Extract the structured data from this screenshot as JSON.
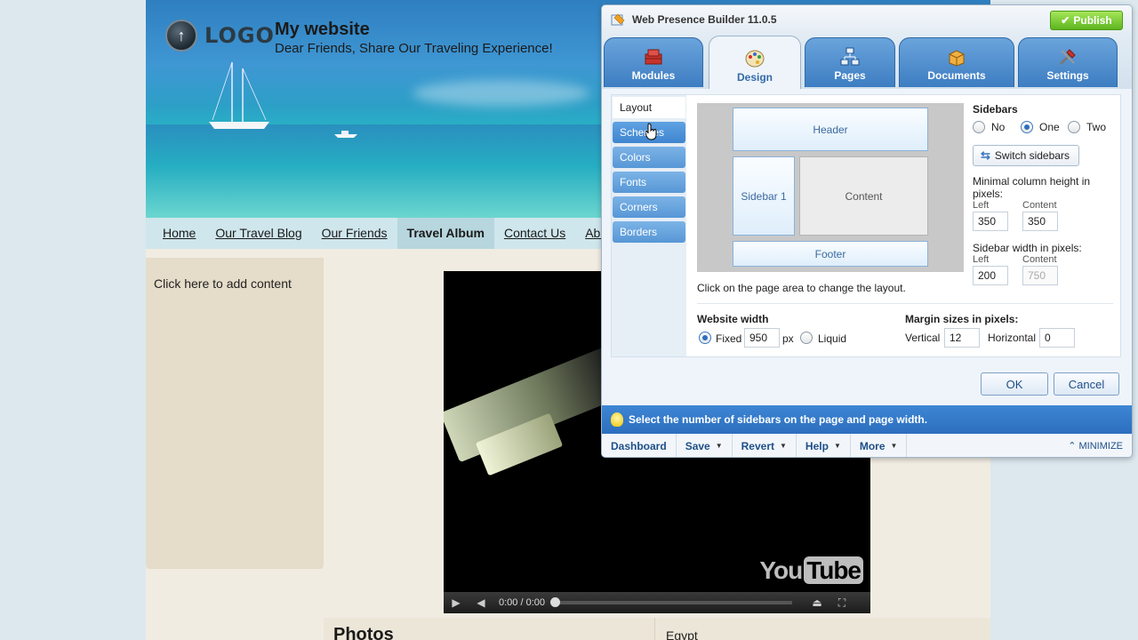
{
  "site": {
    "logo_text": "LOGO",
    "title": "My website",
    "slogan": "Dear Friends, Share Our Traveling Experience!",
    "nav": [
      {
        "label": "Home"
      },
      {
        "label": "Our Travel Blog"
      },
      {
        "label": "Our Friends"
      },
      {
        "label": "Travel Album",
        "active": true
      },
      {
        "label": "Contact Us"
      },
      {
        "label": "About"
      }
    ],
    "add_content": "Click here to add content",
    "video": {
      "time": "0:00 / 0:00",
      "brand_you": "You",
      "brand_tube": "Tube"
    },
    "photos_title": "Photos",
    "photos_caption": "Egypt"
  },
  "builder": {
    "title": "Web Presence Builder 11.0.5",
    "publish_label": "Publish",
    "tabs": [
      {
        "label": "Modules",
        "icon": "modules-icon"
      },
      {
        "label": "Design",
        "icon": "design-icon",
        "active": true
      },
      {
        "label": "Pages",
        "icon": "pages-icon"
      },
      {
        "label": "Documents",
        "icon": "documents-icon"
      },
      {
        "label": "Settings",
        "icon": "settings-icon"
      }
    ],
    "side_menu": [
      "Layout",
      "Schemes",
      "Colors",
      "Fonts",
      "Corners",
      "Borders"
    ],
    "side_menu_active": "Layout",
    "preview": {
      "header": "Header",
      "sidebar": "Sidebar 1",
      "content": "Content",
      "footer": "Footer",
      "hint": "Click on the page area to change the layout."
    },
    "sidebars": {
      "title": "Sidebars",
      "options": [
        "No",
        "One",
        "Two"
      ],
      "selected": "One",
      "switch_label": "Switch sidebars"
    },
    "min_height": {
      "title": "Minimal column height in pixels:",
      "left_label": "Left",
      "left_value": "350",
      "content_label": "Content",
      "content_value": "350"
    },
    "sidebar_width": {
      "title": "Sidebar width in pixels:",
      "left_label": "Left",
      "left_value": "200",
      "content_label": "Content",
      "content_value": "750"
    },
    "website_width": {
      "title": "Website width",
      "fixed_label": "Fixed",
      "value": "950",
      "unit": "px",
      "liquid_label": "Liquid",
      "selected": "Fixed"
    },
    "margins": {
      "title": "Margin sizes in pixels:",
      "vertical_label": "Vertical",
      "vertical_value": "12",
      "horizontal_label": "Horizontal",
      "horizontal_value": "0"
    },
    "ok_label": "OK",
    "cancel_label": "Cancel",
    "info": "Select the number of sidebars on the page and page width.",
    "bottom": {
      "dashboard": "Dashboard",
      "save": "Save",
      "revert": "Revert",
      "help": "Help",
      "more": "More",
      "minimize": "MINIMIZE"
    }
  },
  "colors": {
    "accent": "#3d7dc2",
    "publish": "#5cb51e",
    "info_bar": "#2d6ebf"
  }
}
